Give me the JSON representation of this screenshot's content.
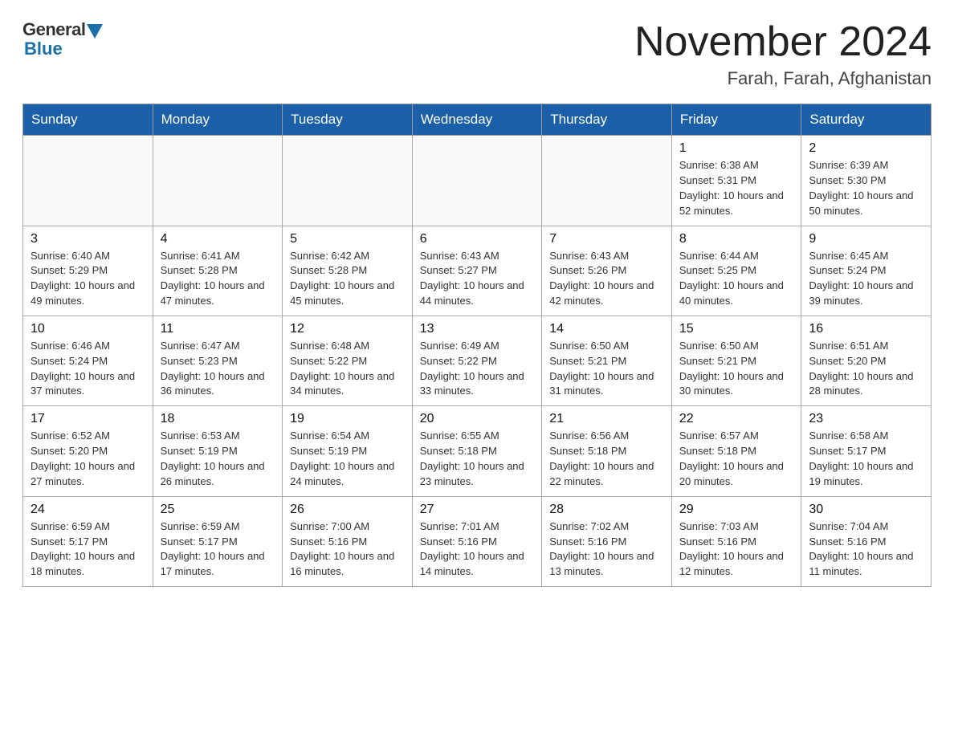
{
  "header": {
    "logo_general": "General",
    "logo_blue": "Blue",
    "month_title": "November 2024",
    "location": "Farah, Farah, Afghanistan"
  },
  "days_of_week": [
    "Sunday",
    "Monday",
    "Tuesday",
    "Wednesday",
    "Thursday",
    "Friday",
    "Saturday"
  ],
  "weeks": [
    [
      {
        "day": "",
        "info": ""
      },
      {
        "day": "",
        "info": ""
      },
      {
        "day": "",
        "info": ""
      },
      {
        "day": "",
        "info": ""
      },
      {
        "day": "",
        "info": ""
      },
      {
        "day": "1",
        "info": "Sunrise: 6:38 AM\nSunset: 5:31 PM\nDaylight: 10 hours and 52 minutes."
      },
      {
        "day": "2",
        "info": "Sunrise: 6:39 AM\nSunset: 5:30 PM\nDaylight: 10 hours and 50 minutes."
      }
    ],
    [
      {
        "day": "3",
        "info": "Sunrise: 6:40 AM\nSunset: 5:29 PM\nDaylight: 10 hours and 49 minutes."
      },
      {
        "day": "4",
        "info": "Sunrise: 6:41 AM\nSunset: 5:28 PM\nDaylight: 10 hours and 47 minutes."
      },
      {
        "day": "5",
        "info": "Sunrise: 6:42 AM\nSunset: 5:28 PM\nDaylight: 10 hours and 45 minutes."
      },
      {
        "day": "6",
        "info": "Sunrise: 6:43 AM\nSunset: 5:27 PM\nDaylight: 10 hours and 44 minutes."
      },
      {
        "day": "7",
        "info": "Sunrise: 6:43 AM\nSunset: 5:26 PM\nDaylight: 10 hours and 42 minutes."
      },
      {
        "day": "8",
        "info": "Sunrise: 6:44 AM\nSunset: 5:25 PM\nDaylight: 10 hours and 40 minutes."
      },
      {
        "day": "9",
        "info": "Sunrise: 6:45 AM\nSunset: 5:24 PM\nDaylight: 10 hours and 39 minutes."
      }
    ],
    [
      {
        "day": "10",
        "info": "Sunrise: 6:46 AM\nSunset: 5:24 PM\nDaylight: 10 hours and 37 minutes."
      },
      {
        "day": "11",
        "info": "Sunrise: 6:47 AM\nSunset: 5:23 PM\nDaylight: 10 hours and 36 minutes."
      },
      {
        "day": "12",
        "info": "Sunrise: 6:48 AM\nSunset: 5:22 PM\nDaylight: 10 hours and 34 minutes."
      },
      {
        "day": "13",
        "info": "Sunrise: 6:49 AM\nSunset: 5:22 PM\nDaylight: 10 hours and 33 minutes."
      },
      {
        "day": "14",
        "info": "Sunrise: 6:50 AM\nSunset: 5:21 PM\nDaylight: 10 hours and 31 minutes."
      },
      {
        "day": "15",
        "info": "Sunrise: 6:50 AM\nSunset: 5:21 PM\nDaylight: 10 hours and 30 minutes."
      },
      {
        "day": "16",
        "info": "Sunrise: 6:51 AM\nSunset: 5:20 PM\nDaylight: 10 hours and 28 minutes."
      }
    ],
    [
      {
        "day": "17",
        "info": "Sunrise: 6:52 AM\nSunset: 5:20 PM\nDaylight: 10 hours and 27 minutes."
      },
      {
        "day": "18",
        "info": "Sunrise: 6:53 AM\nSunset: 5:19 PM\nDaylight: 10 hours and 26 minutes."
      },
      {
        "day": "19",
        "info": "Sunrise: 6:54 AM\nSunset: 5:19 PM\nDaylight: 10 hours and 24 minutes."
      },
      {
        "day": "20",
        "info": "Sunrise: 6:55 AM\nSunset: 5:18 PM\nDaylight: 10 hours and 23 minutes."
      },
      {
        "day": "21",
        "info": "Sunrise: 6:56 AM\nSunset: 5:18 PM\nDaylight: 10 hours and 22 minutes."
      },
      {
        "day": "22",
        "info": "Sunrise: 6:57 AM\nSunset: 5:18 PM\nDaylight: 10 hours and 20 minutes."
      },
      {
        "day": "23",
        "info": "Sunrise: 6:58 AM\nSunset: 5:17 PM\nDaylight: 10 hours and 19 minutes."
      }
    ],
    [
      {
        "day": "24",
        "info": "Sunrise: 6:59 AM\nSunset: 5:17 PM\nDaylight: 10 hours and 18 minutes."
      },
      {
        "day": "25",
        "info": "Sunrise: 6:59 AM\nSunset: 5:17 PM\nDaylight: 10 hours and 17 minutes."
      },
      {
        "day": "26",
        "info": "Sunrise: 7:00 AM\nSunset: 5:16 PM\nDaylight: 10 hours and 16 minutes."
      },
      {
        "day": "27",
        "info": "Sunrise: 7:01 AM\nSunset: 5:16 PM\nDaylight: 10 hours and 14 minutes."
      },
      {
        "day": "28",
        "info": "Sunrise: 7:02 AM\nSunset: 5:16 PM\nDaylight: 10 hours and 13 minutes."
      },
      {
        "day": "29",
        "info": "Sunrise: 7:03 AM\nSunset: 5:16 PM\nDaylight: 10 hours and 12 minutes."
      },
      {
        "day": "30",
        "info": "Sunrise: 7:04 AM\nSunset: 5:16 PM\nDaylight: 10 hours and 11 minutes."
      }
    ]
  ]
}
